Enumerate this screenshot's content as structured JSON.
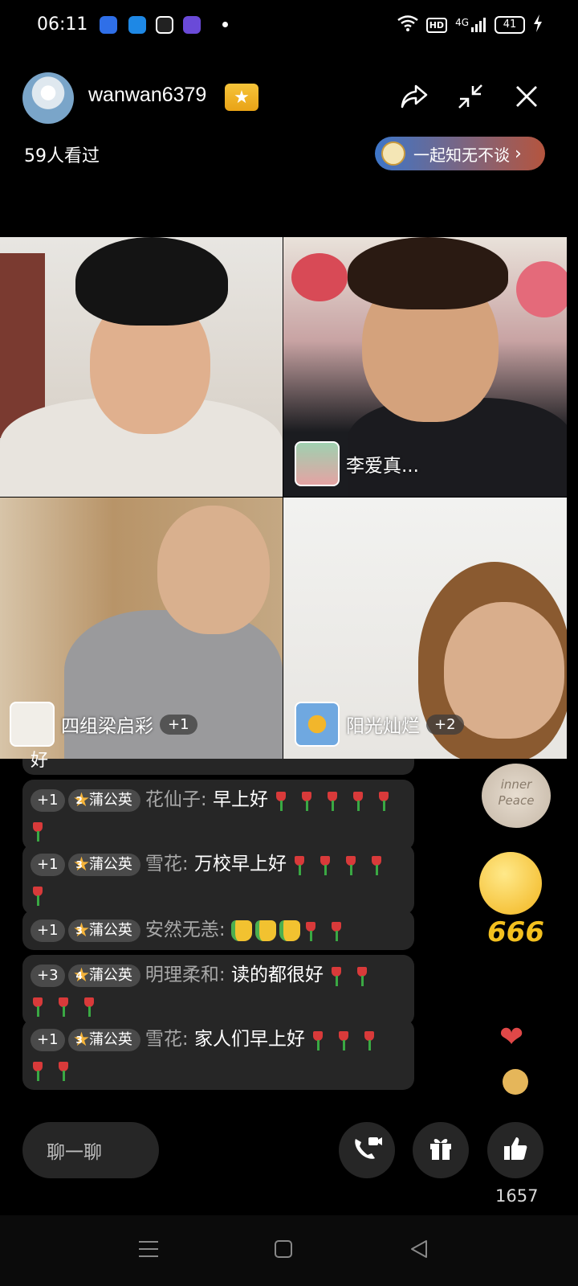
{
  "status_bar": {
    "time": "06:11",
    "hd": "HD",
    "network": "4G",
    "battery": "41"
  },
  "header": {
    "username": "wanwan6379",
    "viewers": "59人看过",
    "topic_label": "一起知无不谈",
    "topic_arrow": "›"
  },
  "participants": [
    {
      "name": "李爱真...",
      "count": ""
    },
    {
      "name": "四组梁启彩",
      "count": "+1"
    },
    {
      "name": "阳光灿烂",
      "count": "+2"
    }
  ],
  "chat": {
    "partial_text": "好",
    "messages": [
      {
        "level": "+1",
        "fan_level": "2",
        "fan_name": "蒲公英",
        "sender": "花仙子:",
        "text": "早上好",
        "tulips": 6,
        "thumbs": 0
      },
      {
        "level": "+1",
        "fan_level": "3",
        "fan_name": "蒲公英",
        "sender": "雪花:",
        "text": "万校早上好",
        "tulips": 5,
        "thumbs": 0
      },
      {
        "level": "+1",
        "fan_level": "3",
        "fan_name": "蒲公英",
        "sender": "安然无恙:",
        "text": "",
        "tulips": 2,
        "thumbs": 3
      },
      {
        "level": "+3",
        "fan_level": "4",
        "fan_name": "蒲公英",
        "sender": "明理柔和:",
        "text": "读的都很好",
        "tulips": 5,
        "thumbs": 0
      },
      {
        "level": "+1",
        "fan_level": "3",
        "fan_name": "蒲公英",
        "sender": "雪花:",
        "text": "家人们早上好",
        "tulips": 5,
        "thumbs": 0
      }
    ]
  },
  "decor": {
    "inner_peace_text": "inner Peace",
    "emoji_666": "666"
  },
  "bottom": {
    "chat_placeholder": "聊一聊",
    "like_count": "1657"
  },
  "colors": {
    "background": "#000000",
    "bubble": "#262626",
    "sender": "#a8a8a8",
    "star": "#f4b33a",
    "topic_gradient": [
      "#3d76c9",
      "#b5553e"
    ]
  }
}
